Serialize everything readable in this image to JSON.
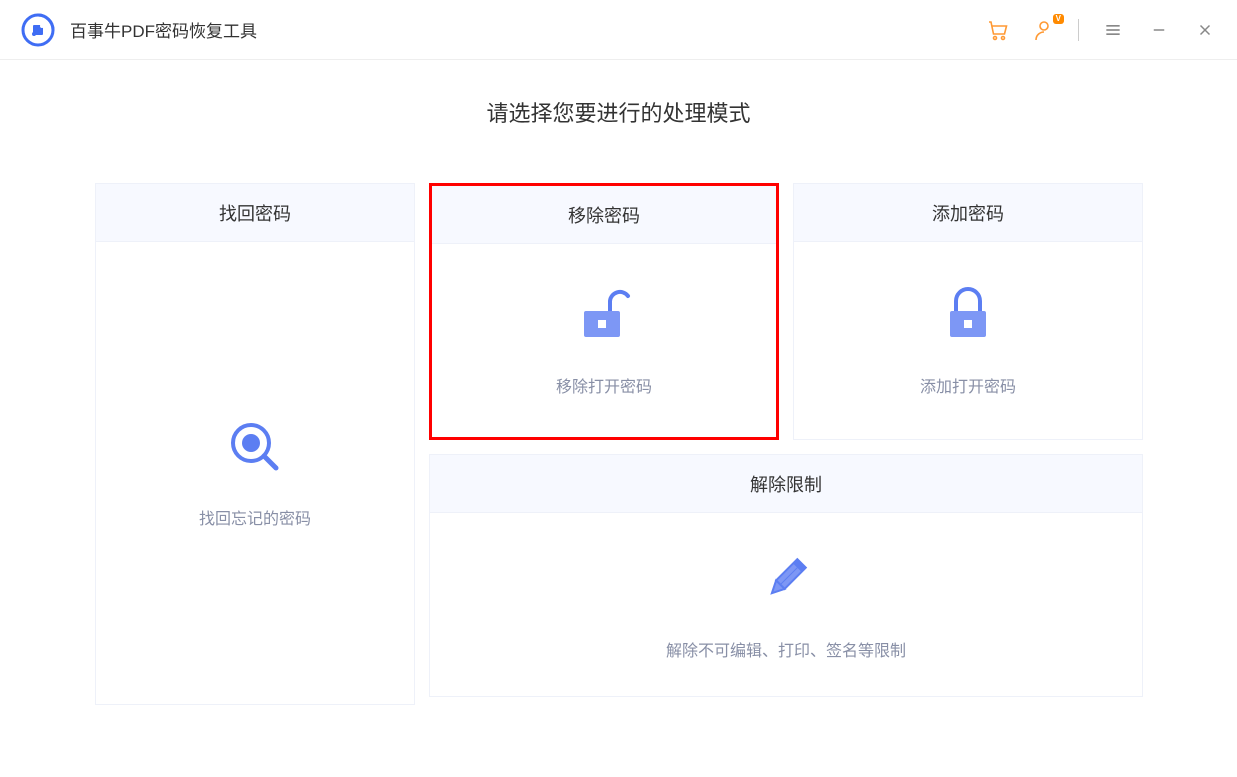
{
  "header": {
    "app_title": "百事牛PDF密码恢复工具",
    "vip_label": "V"
  },
  "main": {
    "subtitle": "请选择您要进行的处理模式",
    "cards": {
      "recover": {
        "title": "找回密码",
        "desc": "找回忘记的密码"
      },
      "remove": {
        "title": "移除密码",
        "desc": "移除打开密码"
      },
      "add": {
        "title": "添加密码",
        "desc": "添加打开密码"
      },
      "restrict": {
        "title": "解除限制",
        "desc": "解除不可编辑、打印、签名等限制"
      }
    }
  }
}
